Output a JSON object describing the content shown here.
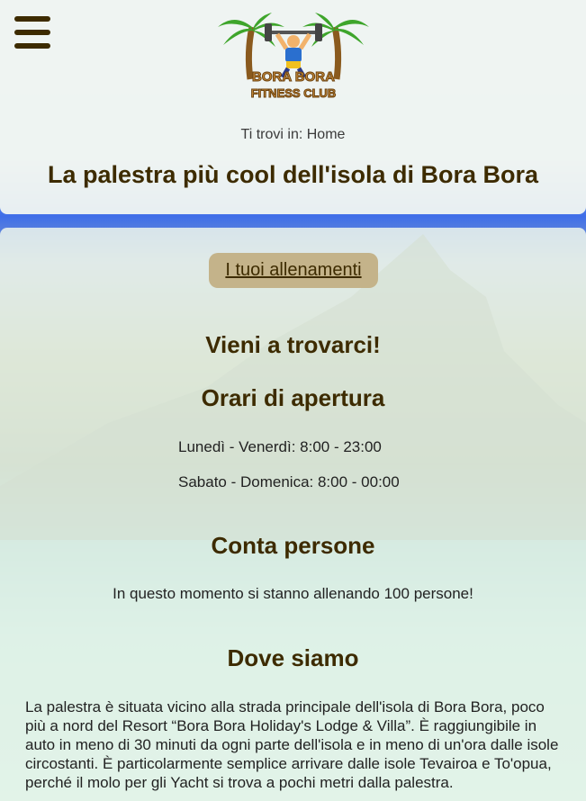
{
  "header": {
    "menu_icon": "hamburger-menu-icon",
    "logo": {
      "line1": "BORA BORA",
      "line2": "FITNESS CLUB",
      "icon": "palm-trees-weightlifter-logo"
    },
    "breadcrumb": {
      "prefix": "Ti trovi in:",
      "current": "Home"
    },
    "title": "La palestra più cool dell'isola di Bora Bora"
  },
  "main": {
    "workouts_button": "I tuoi allenamenti",
    "visit_heading": "Vieni a trovarci!",
    "hours_heading": "Orari di apertura",
    "hours": [
      "Lunedì - Venerdì: 8:00 - 23:00",
      "Sabato - Domenica: 8:00 - 00:00"
    ],
    "people_heading": "Conta persone",
    "people_text": "In questo momento si stanno allenando 100 persone!",
    "where_heading": "Dove siamo",
    "where_text": "La palestra è situata vicino alla strada principale dell'isola di Bora Bora, poco più a nord del Resort “Bora Bora Holiday's Lodge & Villa”. È raggiungibile in auto in meno di 30 minuti da ogni parte dell'isola e in meno di un'ora dalle isole circostanti. È particolarmente semplice arrivare dalle isole Tevairoa e To'opua, perché il molo per gli Yacht si trova a pochi metri dalla palestra."
  },
  "colors": {
    "text_brown": "#3d2b00",
    "button_bg": "#c4b38a"
  }
}
